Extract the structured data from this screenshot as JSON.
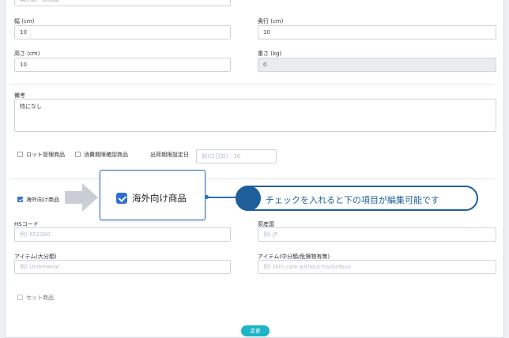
{
  "top_field": {
    "value": "試作品・開発品"
  },
  "width": {
    "label": "幅 (cm)",
    "value": "10"
  },
  "depth": {
    "label": "奥行 (cm)",
    "value": "10"
  },
  "height": {
    "label": "高さ (cm)",
    "value": "10"
  },
  "weight": {
    "label": "重さ (kg)",
    "value": "0"
  },
  "remarks": {
    "label": "備考",
    "value": "特になし"
  },
  "options": {
    "lot": "ロット管理商品",
    "expiry": "消費期限確認商品",
    "ship_limit_label": "出荷期限設定日",
    "ship_limit_placeholder": "例)口日前) : 16"
  },
  "overseas": {
    "label": "海外向け商品",
    "checked": true
  },
  "callout": {
    "text": "海外向け商品"
  },
  "note": {
    "text": "チェックを入れると下の項目が編集可能です"
  },
  "hs": {
    "label": "HSコード",
    "placeholder": "例) 852380"
  },
  "origin": {
    "label": "原産国",
    "placeholder": "例) JP"
  },
  "item_major": {
    "label": "アイテム(大分類)",
    "placeholder": "例) Underwear"
  },
  "item_minor": {
    "label": "アイテム(中分類/危険物有無)",
    "placeholder": "例) skin care without-hazardous"
  },
  "set": {
    "label": "セット商品"
  },
  "submit": {
    "label": "変更"
  },
  "colors": {
    "accent": "#1bb5c6",
    "checkbox": "#2f6fd1",
    "callout": "#1f5f9c"
  }
}
